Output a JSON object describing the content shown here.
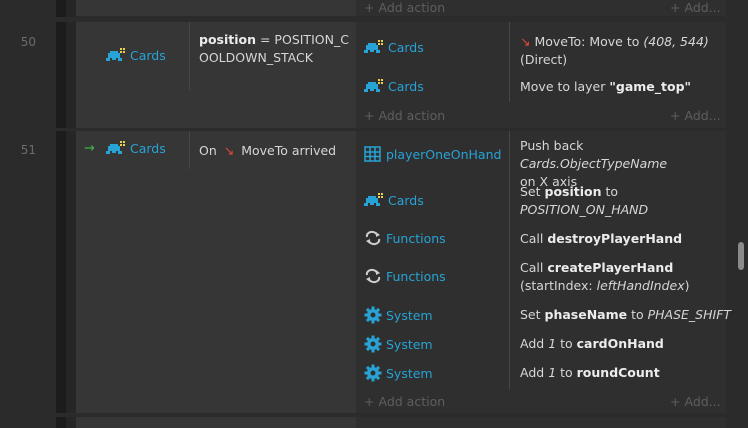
{
  "add_action": "Add action",
  "add_ellipsis": "Add...",
  "rows": [
    {
      "line": "50",
      "condition_object": "Cards",
      "condition_text_bold": "position",
      "condition_text_rest": " = POSITION_COOLDOWN_STACK",
      "actions": [
        {
          "object": "Cards",
          "text": "MoveTo: Move to ",
          "coords": "(408, 544)",
          "extra": "(Direct)"
        },
        {
          "object": "Cards",
          "pre": "Move to layer ",
          "bold": "\"game_top\""
        }
      ]
    },
    {
      "line": "51",
      "condition_object": "Cards",
      "condition_prefix": "On",
      "condition_behavior": "MoveTo arrived",
      "actions": [
        {
          "object": "playerOneOnHand",
          "pre": "Push back ",
          "italic": "Cards.ObjectTypeName",
          "post": " on X axis"
        },
        {
          "object": "Cards",
          "pre": "Set ",
          "bold": "position",
          "mid": " to ",
          "italic": "POSITION_ON_HAND"
        },
        {
          "object": "Functions",
          "pre": "Call ",
          "bold": "destroyPlayerHand"
        },
        {
          "object": "Functions",
          "pre": "Call ",
          "bold": "createPlayerHand",
          "extra_pre": "(startIndex: ",
          "extra_italic": "leftHandIndex",
          "extra_post": ")"
        },
        {
          "object": "System",
          "pre": "Set ",
          "bold": "phaseName",
          "mid": " to ",
          "italic": "PHASE_SHIFT"
        },
        {
          "object": "System",
          "pre": "Add ",
          "italic": "1",
          "mid": " to ",
          "bold": "cardOnHand"
        },
        {
          "object": "System",
          "pre": "Add ",
          "italic": "1",
          "mid": " to ",
          "bold": "roundCount"
        }
      ]
    }
  ],
  "colors": {
    "object_blue": "#27a3d6",
    "arrow_green": "#41b94a",
    "moveto_red": "#e04a3a"
  },
  "icons": {
    "sprite": "sprite-icon",
    "array": "array-icon",
    "function": "function-icon",
    "system": "gear-icon",
    "behavior": "moveto-icon",
    "trigger": "trigger-arrow-icon"
  }
}
